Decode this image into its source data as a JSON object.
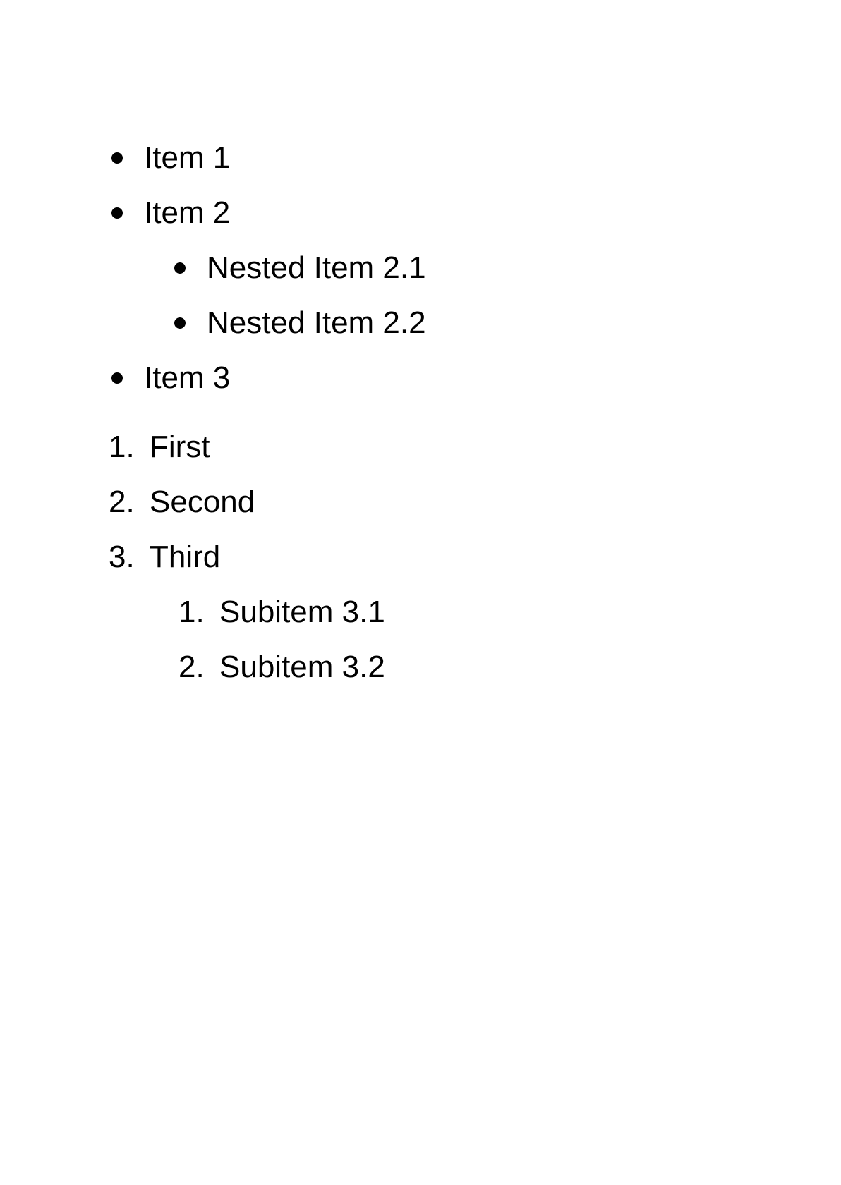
{
  "bullet_list": {
    "items": [
      {
        "label": "Item 1"
      },
      {
        "label": "Item 2",
        "children": [
          {
            "label": "Nested Item 2.1"
          },
          {
            "label": "Nested Item 2.2"
          }
        ]
      },
      {
        "label": "Item 3"
      }
    ]
  },
  "numbered_list": {
    "items": [
      {
        "marker": "1.",
        "label": "First"
      },
      {
        "marker": "2.",
        "label": "Second"
      },
      {
        "marker": "3.",
        "label": "Third",
        "children": [
          {
            "marker": "1.",
            "label": "Subitem 3.1"
          },
          {
            "marker": "2.",
            "label": "Subitem 3.2"
          }
        ]
      }
    ]
  }
}
